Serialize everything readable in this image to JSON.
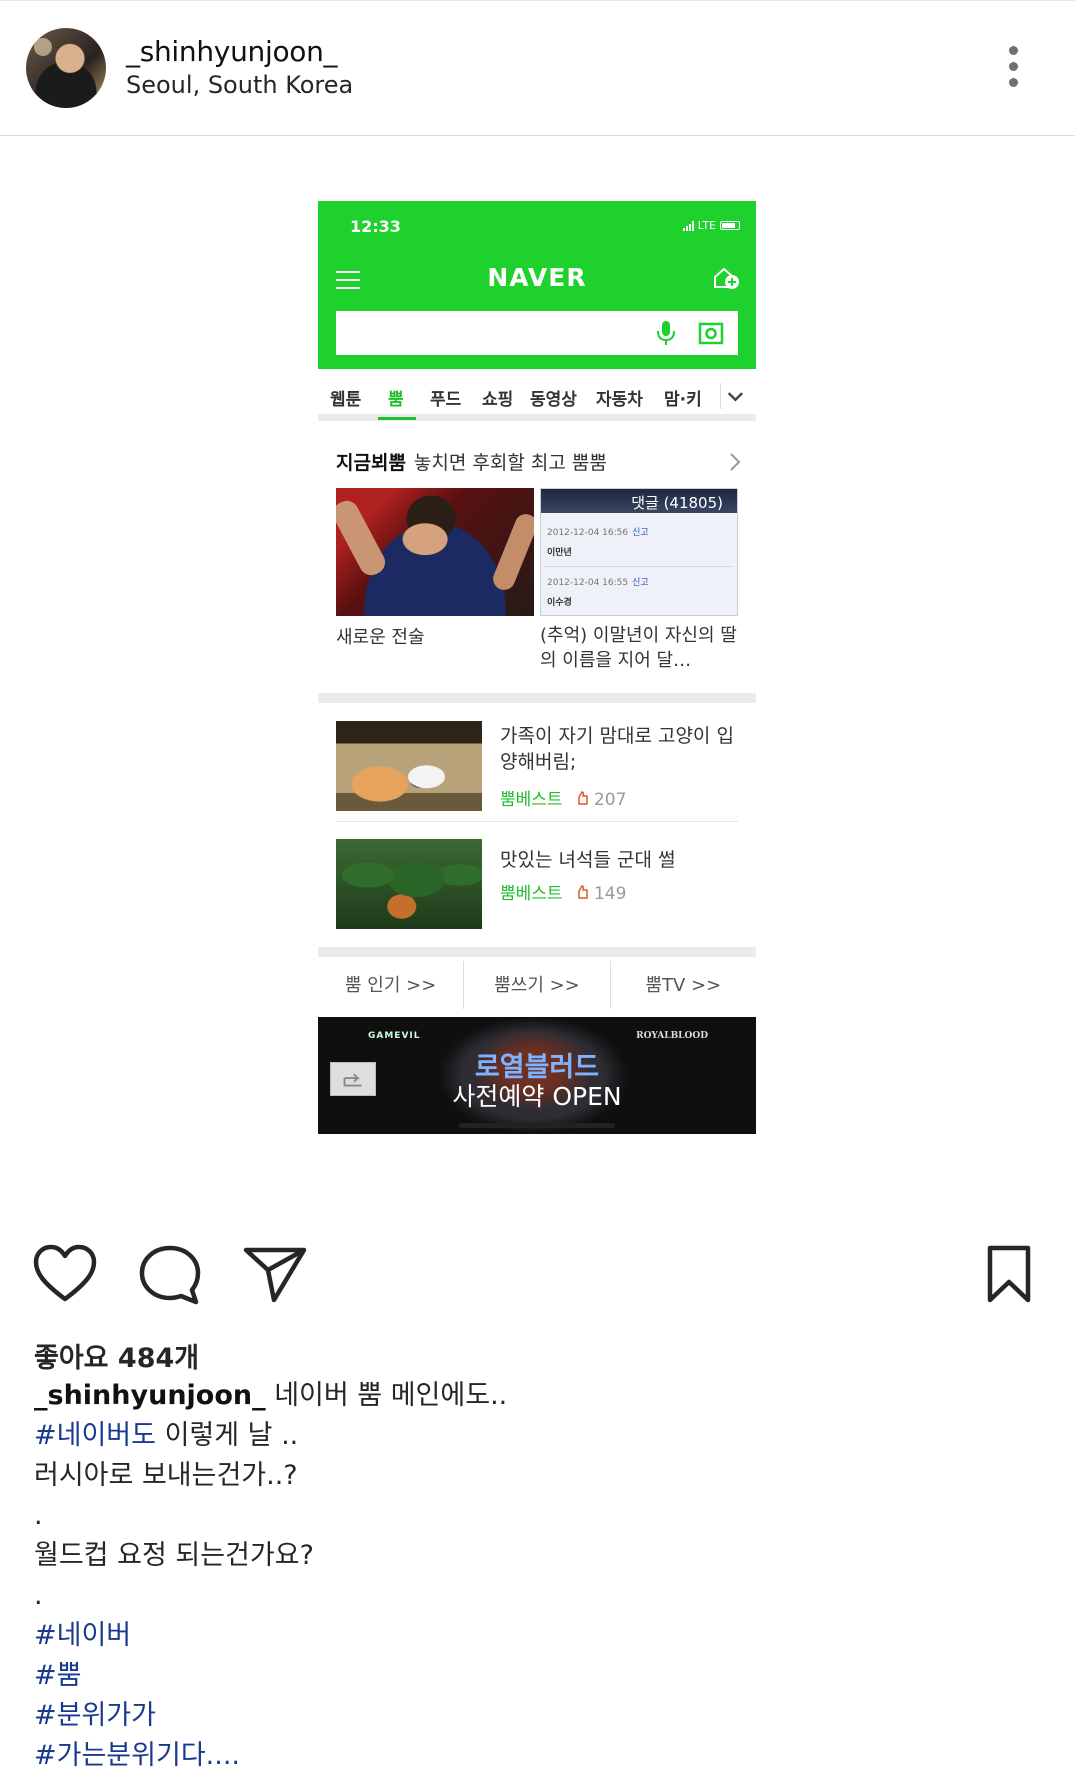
{
  "post": {
    "username": "_shinhyunjoon_",
    "location": "Seoul, South Korea"
  },
  "screenshot": {
    "time": "12:33",
    "network": "LTE",
    "logo": "NAVER",
    "tabs": [
      "웹툰",
      "뿜",
      "푸드",
      "쇼핑",
      "동영상",
      "자동차",
      "맘·키"
    ],
    "active_tab_index": 1,
    "section_title": "지금뵈뿜",
    "section_subtitle": "놓치면 후회할 최고 뿜뿜",
    "card1_caption": "새로운 전술",
    "card2_header": "댓글 (41805)",
    "card2_row1_meta": "2012-12-04 16:56",
    "card2_row1_report": "신고",
    "card2_row1_name": "이만년",
    "card2_row2_meta": "2012-12-04 16:55",
    "card2_row2_report": "신고",
    "card2_row2_name": "이수경",
    "card2_caption": "(추억) 이말년이 자신의 딸의 이름을 지어 달…",
    "items": [
      {
        "title": "가족이 자기 맘대로 고양이 입양해버림;",
        "source": "뿜베스트",
        "likes": "207"
      },
      {
        "title": "맛있는 녀석들 군대 썰",
        "source": "뿜베스트",
        "likes": "149"
      }
    ],
    "bottom_links": [
      "뿜 인기 >>",
      "뿜쓰기 >>",
      "뿜TV >>"
    ],
    "ad": {
      "brand_left": "GAMEVIL",
      "brand_right": "ROYALBLOOD",
      "title": "로열블러드",
      "subtitle": "사전예약 OPEN"
    }
  },
  "likes_text": "좋아요 484개",
  "caption": {
    "user": "_shinhyunjoon_",
    "line1_text": " 네이버 뿜 메인에도..",
    "line2_tag": "#네이버도",
    "line2_text": " 이렇게 날 ..",
    "line3": "러시아로 보내는건가..?",
    "line4": ".",
    "line5": "월드컵 요정 되는건가요?",
    "line6": ".",
    "tags": [
      "#네이버",
      "#뿜",
      "#분위가가",
      "#가는분위기다...."
    ]
  },
  "icons": [
    "more-icon",
    "heart-icon",
    "comment-icon",
    "share-icon",
    "bookmark-icon",
    "menu-icon",
    "home-plus-icon",
    "mic-icon",
    "camera-search-icon",
    "chevron-right-icon",
    "chevron-down-icon",
    "like-thumb-icon"
  ],
  "colors": {
    "naver_green": "#1fd12d",
    "hashtag": "#1a3a8f"
  }
}
